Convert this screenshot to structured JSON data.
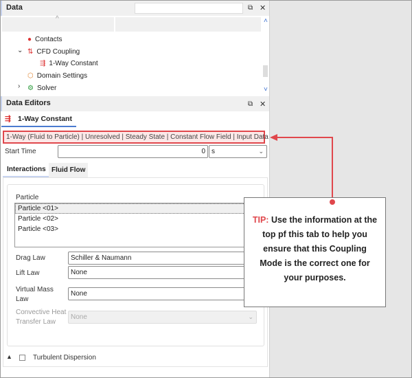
{
  "data_panel": {
    "title": "Data",
    "search_value": "",
    "tree": [
      {
        "label": "Contacts",
        "icon": "contacts-icon",
        "color": "#d33"
      },
      {
        "label": "CFD Coupling",
        "icon": "cfd-coupling-icon",
        "expanded": true
      },
      {
        "label": "1-Way Constant",
        "icon": "coupling-mode-icon"
      },
      {
        "label": "Domain Settings",
        "icon": "domain-settings-icon"
      },
      {
        "label": "Solver",
        "icon": "solver-icon",
        "expanded": false
      }
    ]
  },
  "editors": {
    "title": "Data Editors",
    "tab": "1-Way Constant",
    "info_bar": "1-Way (Fluid to Particle) | Unresolved | Steady State | Constant Flow Field | Input Data",
    "start_time_label": "Start Time",
    "start_time_value": "0",
    "start_time_unit": "s",
    "tabs": [
      "Interactions",
      "Fluid Flow"
    ],
    "particle_label": "Particle",
    "particles": [
      "Particle <01>",
      "Particle <02>",
      "Particle <03>"
    ],
    "drag_law_label": "Drag Law",
    "drag_law": "Schiller & Naumann",
    "lift_law_label": "Lift Law",
    "lift_law": "None",
    "virtual_mass_label_1": "Virtual Mass",
    "virtual_mass_label_2": "Law",
    "virtual_mass": "None",
    "convective_label_1": "Convective Heat",
    "convective_label_2": "Transfer Law",
    "convective": "None",
    "turbulent_label": "Turbulent Dispersion",
    "turbulent_checked": false
  },
  "tip": {
    "prefix": "TIP:",
    "text": "Use the information at the top pf this tab to help you ensure that this Coupling Mode is the correct one for your purposes."
  },
  "colors": {
    "accent_red": "#e0474c",
    "tab_underline": "#4a7bd0"
  }
}
